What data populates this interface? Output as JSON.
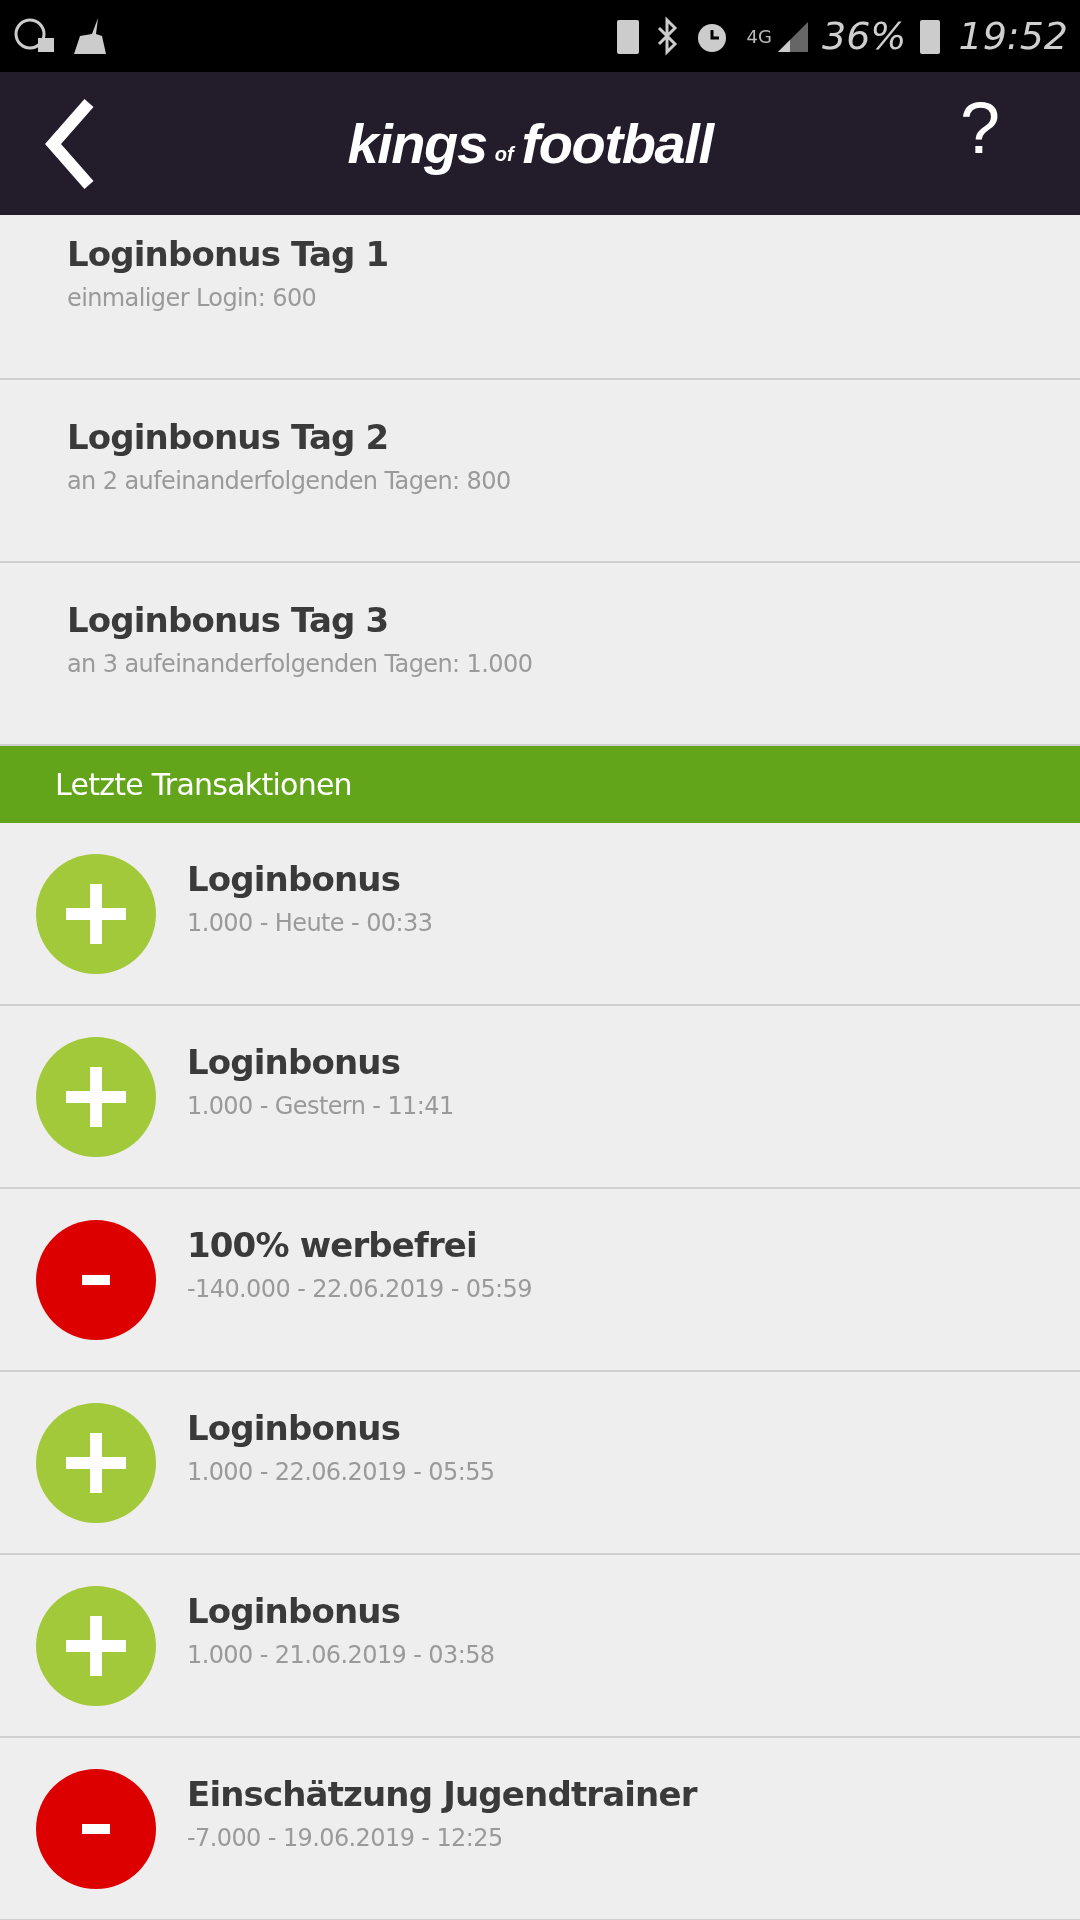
{
  "status_bar": {
    "network": "4G",
    "battery": "36%",
    "time": "19:52"
  },
  "header": {
    "logo": [
      "kings",
      "of",
      "football"
    ],
    "help": "?"
  },
  "bonuses": [
    {
      "title": "Loginbonus Tag 1",
      "subtitle": "einmaliger Login: 600"
    },
    {
      "title": "Loginbonus Tag 2",
      "subtitle": "an 2 aufeinanderfolgenden Tagen: 800"
    },
    {
      "title": "Loginbonus Tag 3",
      "subtitle": "an 3 aufeinanderfolgenden Tagen: 1.000"
    }
  ],
  "section_title": "Letzte Transaktionen",
  "transactions": [
    {
      "kind": "plus",
      "title": "Loginbonus",
      "detail": "1.000 - Heute - 00:33"
    },
    {
      "kind": "plus",
      "title": "Loginbonus",
      "detail": "1.000 - Gestern - 11:41"
    },
    {
      "kind": "minus",
      "title": "100% werbefrei",
      "detail": "-140.000 - 22.06.2019 - 05:59"
    },
    {
      "kind": "plus",
      "title": "Loginbonus",
      "detail": "1.000 - 22.06.2019 - 05:55"
    },
    {
      "kind": "plus",
      "title": "Loginbonus",
      "detail": "1.000 - 21.06.2019 - 03:58"
    },
    {
      "kind": "minus",
      "title": "Einschätzung Jugendtrainer",
      "detail": "-7.000 - 19.06.2019 - 12:25"
    }
  ]
}
